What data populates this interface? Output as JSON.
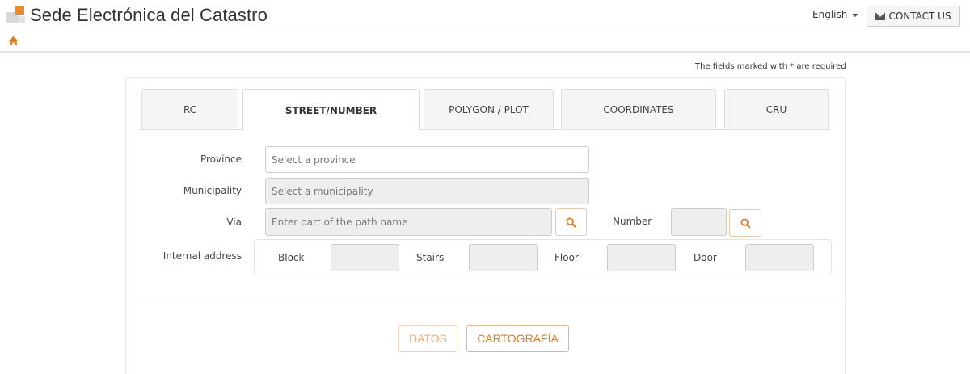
{
  "header": {
    "site_title": "Sede Electrónica del Catastro",
    "language": "English",
    "contact_label": "CONTACT US"
  },
  "required_note": "The fields marked with * are required",
  "tabs": [
    {
      "label": "RC",
      "active": false
    },
    {
      "label": "STREET/NUMBER",
      "active": true
    },
    {
      "label": "POLYGON / PLOT",
      "active": false
    },
    {
      "label": "COORDINATES",
      "active": false
    },
    {
      "label": "CRU",
      "active": false
    }
  ],
  "form": {
    "province_label": "Province",
    "province_placeholder": "Select a province",
    "municipality_label": "Municipality",
    "municipality_placeholder": "Select a municipality",
    "via_label": "Via",
    "via_placeholder": "Enter part of the path name",
    "number_label": "Number",
    "internal_address_label": "Internal address",
    "block_label": "Block",
    "stairs_label": "Stairs",
    "floor_label": "Floor",
    "door_label": "Door"
  },
  "buttons": {
    "datos": "DATOS",
    "cartografia": "CARTOGRAFÍA"
  },
  "colors": {
    "accent": "#e07b1f",
    "logo_orange": "#f08a24"
  }
}
